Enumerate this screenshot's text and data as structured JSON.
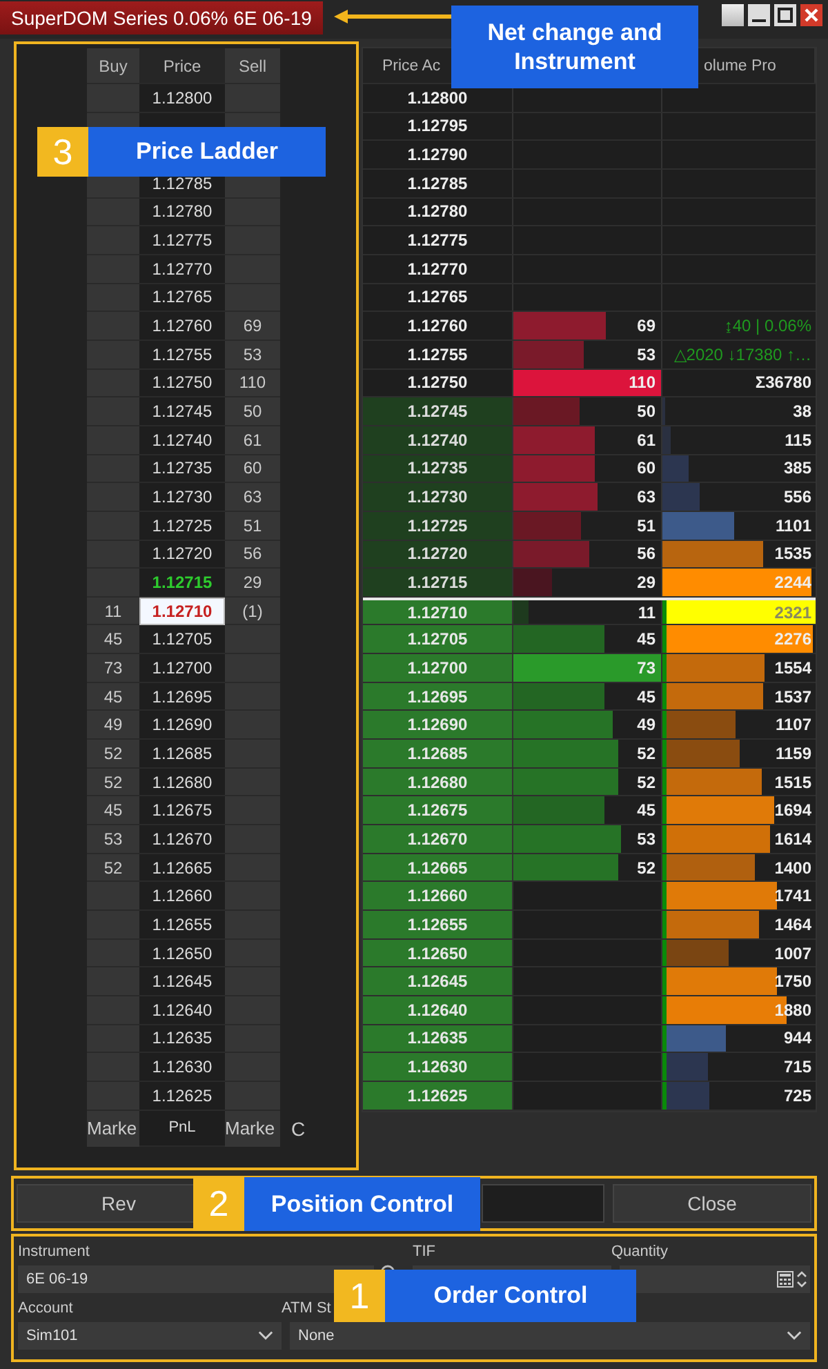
{
  "window": {
    "title": "SuperDOM Series 0.06% 6E 06-19"
  },
  "callouts": [
    {
      "text": "Net change and Instrument",
      "kind": "top"
    },
    {
      "number": "3",
      "text": "Price Ladder",
      "kind": "ladder"
    },
    {
      "number": "2",
      "text": "Position Control",
      "kind": "position"
    },
    {
      "number": "1",
      "text": "Order Control",
      "kind": "order"
    }
  ],
  "ladder": {
    "columns": [
      "Buy",
      "Price",
      "Sell"
    ],
    "rows": [
      {
        "price": "1.12800",
        "kind": "plain"
      },
      {
        "kind": "plain"
      },
      {
        "kind": "hidden"
      },
      {
        "price": "1.12785",
        "kind": "plain"
      },
      {
        "price": "1.12780",
        "kind": "plain"
      },
      {
        "price": "1.12775",
        "kind": "plain"
      },
      {
        "price": "1.12770",
        "kind": "plain"
      },
      {
        "price": "1.12765",
        "kind": "plain"
      },
      {
        "price": "1.12760",
        "sell": "69",
        "kind": "plain"
      },
      {
        "price": "1.12755",
        "sell": "53",
        "kind": "plain"
      },
      {
        "price": "1.12750",
        "sell": "110",
        "kind": "plain"
      },
      {
        "price": "1.12745",
        "sell": "50",
        "kind": "plain"
      },
      {
        "price": "1.12740",
        "sell": "61",
        "kind": "plain"
      },
      {
        "price": "1.12735",
        "sell": "60",
        "kind": "plain"
      },
      {
        "price": "1.12730",
        "sell": "63",
        "kind": "plain"
      },
      {
        "price": "1.12725",
        "sell": "51",
        "kind": "plain"
      },
      {
        "price": "1.12720",
        "sell": "56",
        "kind": "plain"
      },
      {
        "price": "1.12715",
        "sell": "29",
        "kind": "ask"
      },
      {
        "price": "1.12710",
        "buy": "11",
        "sell": "(1)",
        "kind": "last"
      },
      {
        "price": "1.12705",
        "buy": "45",
        "kind": "plain"
      },
      {
        "price": "1.12700",
        "buy": "73",
        "kind": "plain"
      },
      {
        "price": "1.12695",
        "buy": "45",
        "kind": "plain"
      },
      {
        "price": "1.12690",
        "buy": "49",
        "kind": "plain"
      },
      {
        "price": "1.12685",
        "buy": "52",
        "kind": "plain"
      },
      {
        "price": "1.12680",
        "buy": "52",
        "kind": "plain"
      },
      {
        "price": "1.12675",
        "buy": "45",
        "kind": "plain"
      },
      {
        "price": "1.12670",
        "buy": "53",
        "kind": "plain"
      },
      {
        "price": "1.12665",
        "buy": "52",
        "kind": "plain"
      },
      {
        "price": "1.12660",
        "kind": "plain"
      },
      {
        "price": "1.12655",
        "kind": "plain"
      },
      {
        "price": "1.12650",
        "kind": "plain"
      },
      {
        "price": "1.12645",
        "kind": "plain"
      },
      {
        "price": "1.12640",
        "kind": "plain"
      },
      {
        "price": "1.12635",
        "kind": "plain"
      },
      {
        "price": "1.12630",
        "kind": "plain"
      },
      {
        "price": "1.12625",
        "kind": "plain"
      }
    ],
    "footer": [
      "Marke",
      "PnL",
      "Marke",
      "C"
    ]
  },
  "depth": {
    "columns": [
      "Price Ac",
      "olume Pro"
    ],
    "rows": [
      {
        "price": "1.12800",
        "kind": "plain"
      },
      {
        "price": "1.12795",
        "kind": "plain"
      },
      {
        "price": "1.12790",
        "kind": "plain"
      },
      {
        "price": "1.12785",
        "kind": "plain"
      },
      {
        "price": "1.12780",
        "kind": "plain"
      },
      {
        "price": "1.12775",
        "kind": "plain"
      },
      {
        "price": "1.12770",
        "kind": "plain"
      },
      {
        "price": "1.12765",
        "kind": "plain"
      },
      {
        "price": "1.12760",
        "kind": "plain",
        "bar": {
          "value": "69",
          "level": 0.63,
          "color": "#8e1b2e"
        },
        "volume": {
          "kind": "stat",
          "text": "↨40 | 0.06%"
        }
      },
      {
        "price": "1.12755",
        "kind": "plain",
        "bar": {
          "value": "53",
          "level": 0.48,
          "color": "#7a1a2a"
        },
        "volume": {
          "kind": "stat",
          "text": "△2020 ↓17380 ↑…"
        }
      },
      {
        "price": "1.12750",
        "kind": "plain",
        "bar": {
          "value": "110",
          "level": 1,
          "color": "#dc143c"
        },
        "volume": {
          "kind": "total",
          "text": "Σ36780"
        }
      },
      {
        "price": "1.12745",
        "kind": "dim",
        "bar": {
          "value": "50",
          "level": 0.45,
          "color": "#6a1824"
        },
        "volume": {
          "kind": "bar",
          "text": "38",
          "level": 0.02,
          "color": "#2a3040"
        }
      },
      {
        "price": "1.12740",
        "kind": "dim",
        "bar": {
          "value": "61",
          "level": 0.55,
          "color": "#8e1b2e"
        },
        "volume": {
          "kind": "bar",
          "text": "115",
          "level": 0.05,
          "color": "#2a3040"
        }
      },
      {
        "price": "1.12735",
        "kind": "dim",
        "bar": {
          "value": "60",
          "level": 0.55,
          "color": "#8e1b2e"
        },
        "volume": {
          "kind": "bar",
          "text": "385",
          "level": 0.17,
          "color": "#2c3650"
        }
      },
      {
        "price": "1.12730",
        "kind": "dim",
        "bar": {
          "value": "63",
          "level": 0.57,
          "color": "#8e1b2e"
        },
        "volume": {
          "kind": "bar",
          "text": "556",
          "level": 0.24,
          "color": "#2c3650"
        }
      },
      {
        "price": "1.12725",
        "kind": "dim",
        "bar": {
          "value": "51",
          "level": 0.46,
          "color": "#6a1824"
        },
        "volume": {
          "kind": "bar",
          "text": "1101",
          "level": 0.47,
          "color": "#3d5a8a"
        }
      },
      {
        "price": "1.12720",
        "kind": "dim",
        "bar": {
          "value": "56",
          "level": 0.51,
          "color": "#7a1a2a"
        },
        "volume": {
          "kind": "bar",
          "text": "1535",
          "level": 0.66,
          "color": "#b8650f"
        }
      },
      {
        "price": "1.12715",
        "kind": "dim",
        "bar": {
          "value": "29",
          "level": 0.26,
          "color": "#4a1520"
        },
        "volume": {
          "kind": "bar",
          "text": "2244",
          "level": 0.97,
          "color": "#ff8c00"
        }
      },
      {
        "price": "1.12710",
        "kind": "bright",
        "bar": {
          "value": "11",
          "level": 0.1,
          "color": "#1e3a1e"
        },
        "volume": {
          "kind": "bar",
          "text": "2321",
          "level": 1,
          "color": "#ffff00"
        }
      },
      {
        "price": "1.12705",
        "kind": "bright",
        "bar": {
          "value": "45",
          "level": 0.62,
          "color": "#236623"
        },
        "volume": {
          "kind": "bar",
          "text": "2276",
          "level": 0.98,
          "color": "#ff8c00"
        }
      },
      {
        "price": "1.12700",
        "kind": "bright",
        "bar": {
          "value": "73",
          "level": 1,
          "color": "#2a9a2a"
        },
        "volume": {
          "kind": "bar",
          "text": "1554",
          "level": 0.67,
          "color": "#c46a0c"
        }
      },
      {
        "price": "1.12695",
        "kind": "bright",
        "bar": {
          "value": "45",
          "level": 0.62,
          "color": "#236623"
        },
        "volume": {
          "kind": "bar",
          "text": "1537",
          "level": 0.66,
          "color": "#c46a0c"
        }
      },
      {
        "price": "1.12690",
        "kind": "bright",
        "bar": {
          "value": "49",
          "level": 0.67,
          "color": "#267326"
        },
        "volume": {
          "kind": "bar",
          "text": "1107",
          "level": 0.48,
          "color": "#8a4c10"
        }
      },
      {
        "price": "1.12685",
        "kind": "bright",
        "bar": {
          "value": "52",
          "level": 0.71,
          "color": "#267326"
        },
        "volume": {
          "kind": "bar",
          "text": "1159",
          "level": 0.5,
          "color": "#8a4c10"
        }
      },
      {
        "price": "1.12680",
        "kind": "bright",
        "bar": {
          "value": "52",
          "level": 0.71,
          "color": "#267326"
        },
        "volume": {
          "kind": "bar",
          "text": "1515",
          "level": 0.65,
          "color": "#c46a0c"
        }
      },
      {
        "price": "1.12675",
        "kind": "bright",
        "bar": {
          "value": "45",
          "level": 0.62,
          "color": "#236623"
        },
        "volume": {
          "kind": "bar",
          "text": "1694",
          "level": 0.73,
          "color": "#e07a08"
        }
      },
      {
        "price": "1.12670",
        "kind": "bright",
        "bar": {
          "value": "53",
          "level": 0.73,
          "color": "#267326"
        },
        "volume": {
          "kind": "bar",
          "text": "1614",
          "level": 0.7,
          "color": "#d07008"
        }
      },
      {
        "price": "1.12665",
        "kind": "bright",
        "bar": {
          "value": "52",
          "level": 0.71,
          "color": "#267326"
        },
        "volume": {
          "kind": "bar",
          "text": "1400",
          "level": 0.6,
          "color": "#b0600f"
        }
      },
      {
        "price": "1.12660",
        "kind": "bright",
        "volume": {
          "kind": "bar",
          "text": "1741",
          "level": 0.75,
          "color": "#e07a08"
        }
      },
      {
        "price": "1.12655",
        "kind": "bright",
        "volume": {
          "kind": "bar",
          "text": "1464",
          "level": 0.63,
          "color": "#c46a0c"
        }
      },
      {
        "price": "1.12650",
        "kind": "bright",
        "volume": {
          "kind": "bar",
          "text": "1007",
          "level": 0.43,
          "color": "#7a4512"
        }
      },
      {
        "price": "1.12645",
        "kind": "bright",
        "volume": {
          "kind": "bar",
          "text": "1750",
          "level": 0.75,
          "color": "#e07a08"
        }
      },
      {
        "price": "1.12640",
        "kind": "bright",
        "volume": {
          "kind": "bar",
          "text": "1880",
          "level": 0.81,
          "color": "#e87d06"
        }
      },
      {
        "price": "1.12635",
        "kind": "bright",
        "volume": {
          "kind": "bar",
          "text": "944",
          "level": 0.41,
          "color": "#3d5a8a"
        }
      },
      {
        "price": "1.12630",
        "kind": "bright",
        "volume": {
          "kind": "bar",
          "text": "715",
          "level": 0.3,
          "color": "#2c3650"
        }
      },
      {
        "price": "1.12625",
        "kind": "bright",
        "volume": {
          "kind": "bar",
          "text": "725",
          "level": 0.31,
          "color": "#2c3650"
        }
      }
    ]
  },
  "position": {
    "buttons": [
      "Rev",
      "Close"
    ]
  },
  "order": {
    "instrument": {
      "label": "Instrument",
      "value": "6E 06-19"
    },
    "tif": {
      "label": "TIF"
    },
    "quantity": {
      "label": "Quantity"
    },
    "account": {
      "label": "Account",
      "value": "Sim101"
    },
    "atm": {
      "label": "ATM St",
      "value": "None"
    }
  }
}
